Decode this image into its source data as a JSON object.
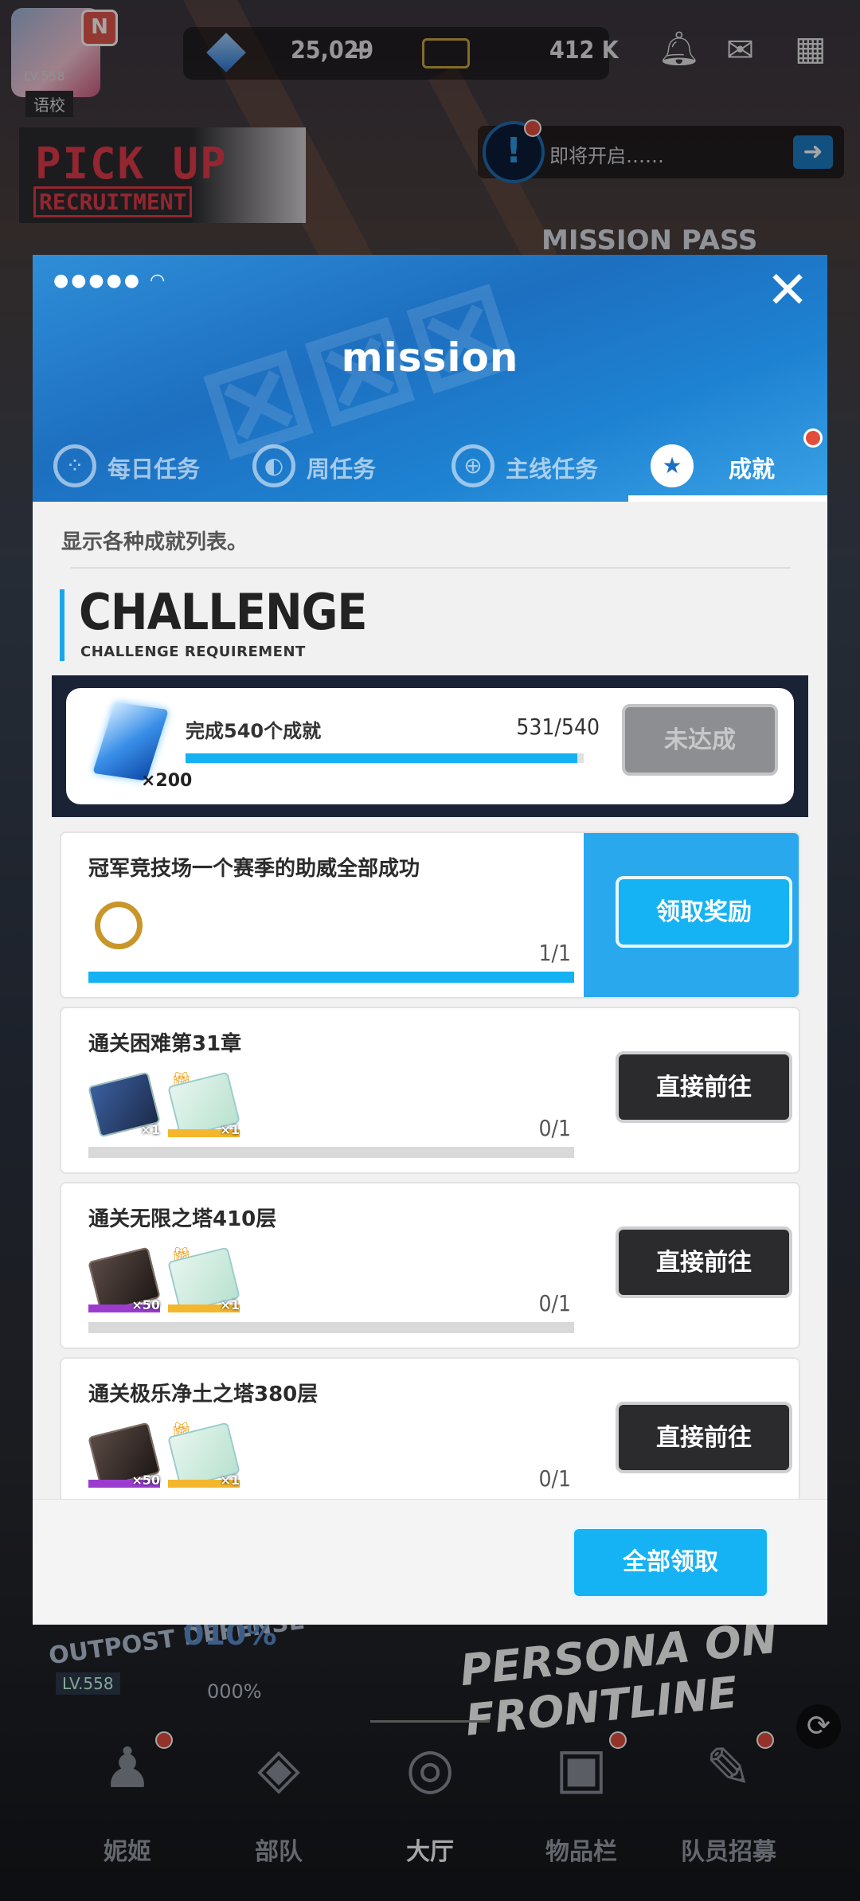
{
  "lobby": {
    "player_level": "LV.558",
    "player_tag": "语校",
    "gems": "25,029",
    "credits": "412 K",
    "banner_title": "PICK UP",
    "banner_subtitle": "RECRUITMENT",
    "notice_text": "即将开启……",
    "mission_pass": "MISSION PASS",
    "outpost": "OUTPOST DEFENSE",
    "outpost_pct": "010%",
    "outpost_level": "LV.558",
    "outpost_pct2": "000%",
    "event_title": "PERSONA ON FRONTLINE",
    "nav": [
      {
        "label": "妮姬"
      },
      {
        "label": "部队"
      },
      {
        "label": "大厅"
      },
      {
        "label": "物品栏"
      },
      {
        "label": "队员招募"
      }
    ]
  },
  "modal": {
    "title": "mission",
    "tabs": [
      {
        "label": "每日任务"
      },
      {
        "label": "周任务"
      },
      {
        "label": "主线任务"
      },
      {
        "label": "成就"
      }
    ],
    "description": "显示各种成就列表。",
    "section_title": "CHALLENGE",
    "section_subtitle": "CHALLENGE REQUIREMENT",
    "challenge": {
      "reward_count": "×200",
      "name": "完成540个成就",
      "progress_text": "531/540",
      "progress_fraction": 0.983,
      "button_label": "未达成"
    },
    "items": [
      {
        "title": "冠军竞技场一个赛季的助威全部成功",
        "progress_text": "1/1",
        "progress_fraction": 1.0,
        "button_label": "领取奖励"
      },
      {
        "title": "通关困难第31章",
        "progress_text": "0/1",
        "progress_fraction": 0,
        "button_label": "直接前往",
        "reward_counts": [
          "×1",
          "×1"
        ]
      },
      {
        "title": "通关无限之塔410层",
        "progress_text": "0/1",
        "progress_fraction": 0,
        "button_label": "直接前往",
        "reward_counts": [
          "×50",
          "×1"
        ]
      },
      {
        "title": "通关极乐净土之塔380层",
        "progress_text": "0/1",
        "progress_fraction": 0,
        "button_label": "直接前往",
        "reward_counts": [
          "×50",
          "×1"
        ]
      }
    ],
    "claim_all_label": "全部领取"
  }
}
